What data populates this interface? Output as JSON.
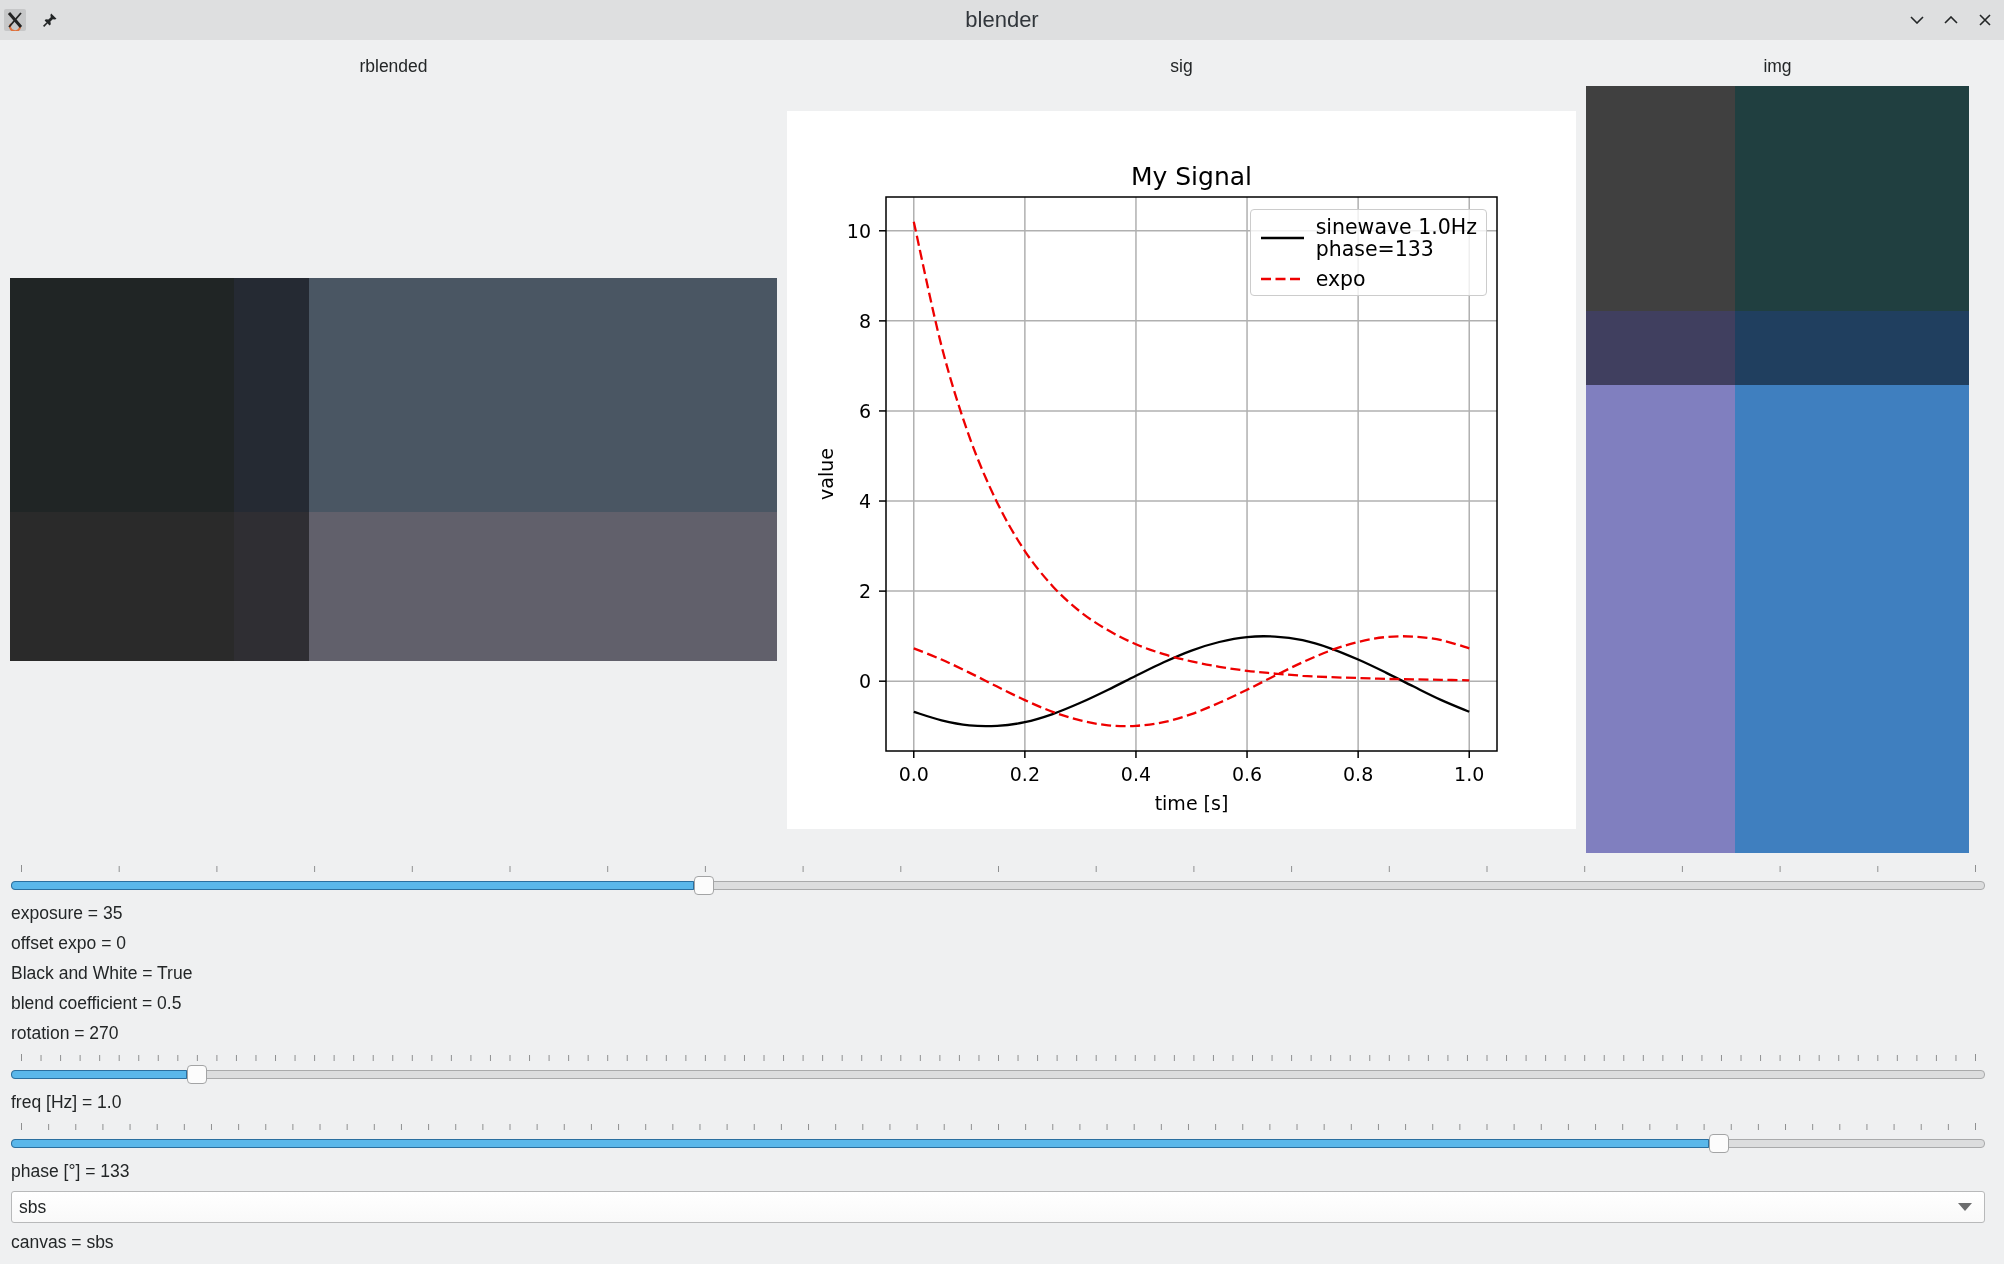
{
  "window": {
    "title": "blender"
  },
  "panels": [
    {
      "kind": "image",
      "title": "rblended"
    },
    {
      "kind": "chart",
      "title": "sig",
      "chart_data": {
        "type": "line",
        "title": "My Signal",
        "xlabel": "time [s]",
        "ylabel": "value",
        "grid": true,
        "legend": "upper right",
        "x": [
          0,
          0.05,
          0.1,
          0.15,
          0.2,
          0.25,
          0.3,
          0.35,
          0.4,
          0.45,
          0.5,
          0.55,
          0.6,
          0.65,
          0.7,
          0.75,
          0.8,
          0.85,
          0.9,
          0.95,
          1
        ],
        "series": [
          {
            "name": "sinewave 1.0Hz\nphase=133",
            "color": "#000000",
            "line_style": "solid",
            "values": [
              -0.68,
              -0.87,
              -0.98,
              -0.99,
              -0.91,
              -0.73,
              -0.48,
              -0.19,
              0.12,
              0.42,
              0.68,
              0.87,
              0.98,
              0.99,
              0.91,
              0.73,
              0.48,
              0.19,
              -0.12,
              -0.42,
              -0.68
            ]
          },
          {
            "name": "expo",
            "color": "#ee0000",
            "line_style": "dashed",
            "values": [
              10.2,
              7.44,
              5.43,
              3.97,
              2.89,
              2.11,
              1.54,
              1.13,
              0.82,
              0.6,
              0.44,
              0.32,
              0.23,
              0.17,
              0.12,
              0.09,
              0.07,
              0.05,
              0.04,
              0.03,
              0.02
            ]
          },
          {
            "color": "#ee0000",
            "line_style": "dashed",
            "values": [
              0.73,
              0.48,
              0.19,
              -0.12,
              -0.42,
              -0.68,
              -0.87,
              -0.98,
              -0.99,
              -0.91,
              -0.73,
              -0.48,
              -0.19,
              0.12,
              0.42,
              0.68,
              0.87,
              0.98,
              0.99,
              0.91,
              0.73
            ]
          }
        ],
        "xlim": [
          -0.05,
          1.05
        ],
        "ylim": [
          -1.55,
          10.75
        ],
        "xticks": [
          {
            "value": 0,
            "label": "0.0"
          },
          {
            "value": 0.2,
            "label": "0.2"
          },
          {
            "value": 0.4,
            "label": "0.4"
          },
          {
            "value": 0.6,
            "label": "0.6"
          },
          {
            "value": 0.8,
            "label": "0.8"
          },
          {
            "value": 1,
            "label": "1.0"
          }
        ],
        "yticks": [
          0,
          2,
          4,
          6,
          8,
          10
        ]
      }
    },
    {
      "kind": "image",
      "title": "img"
    }
  ],
  "controls": [
    {
      "kind": "slider",
      "level": 0.35
    },
    {
      "kind": "label",
      "text": "exposure = 35"
    },
    {
      "kind": "label",
      "text": "offset expo = 0"
    },
    {
      "kind": "label",
      "text": "Black and White = True"
    },
    {
      "kind": "label",
      "text": "blend coefficient = 0.5"
    },
    {
      "kind": "label",
      "text": "rotation = 270"
    },
    {
      "kind": "slider",
      "level": 0.09
    },
    {
      "kind": "label",
      "text": "freq [Hz] = 1.0"
    },
    {
      "kind": "slider",
      "level": 0.87
    },
    {
      "kind": "label",
      "text": "phase [°] = 133"
    },
    {
      "kind": "dropdown",
      "value": "sbs"
    },
    {
      "kind": "label",
      "text": "canvas = sbs"
    }
  ]
}
